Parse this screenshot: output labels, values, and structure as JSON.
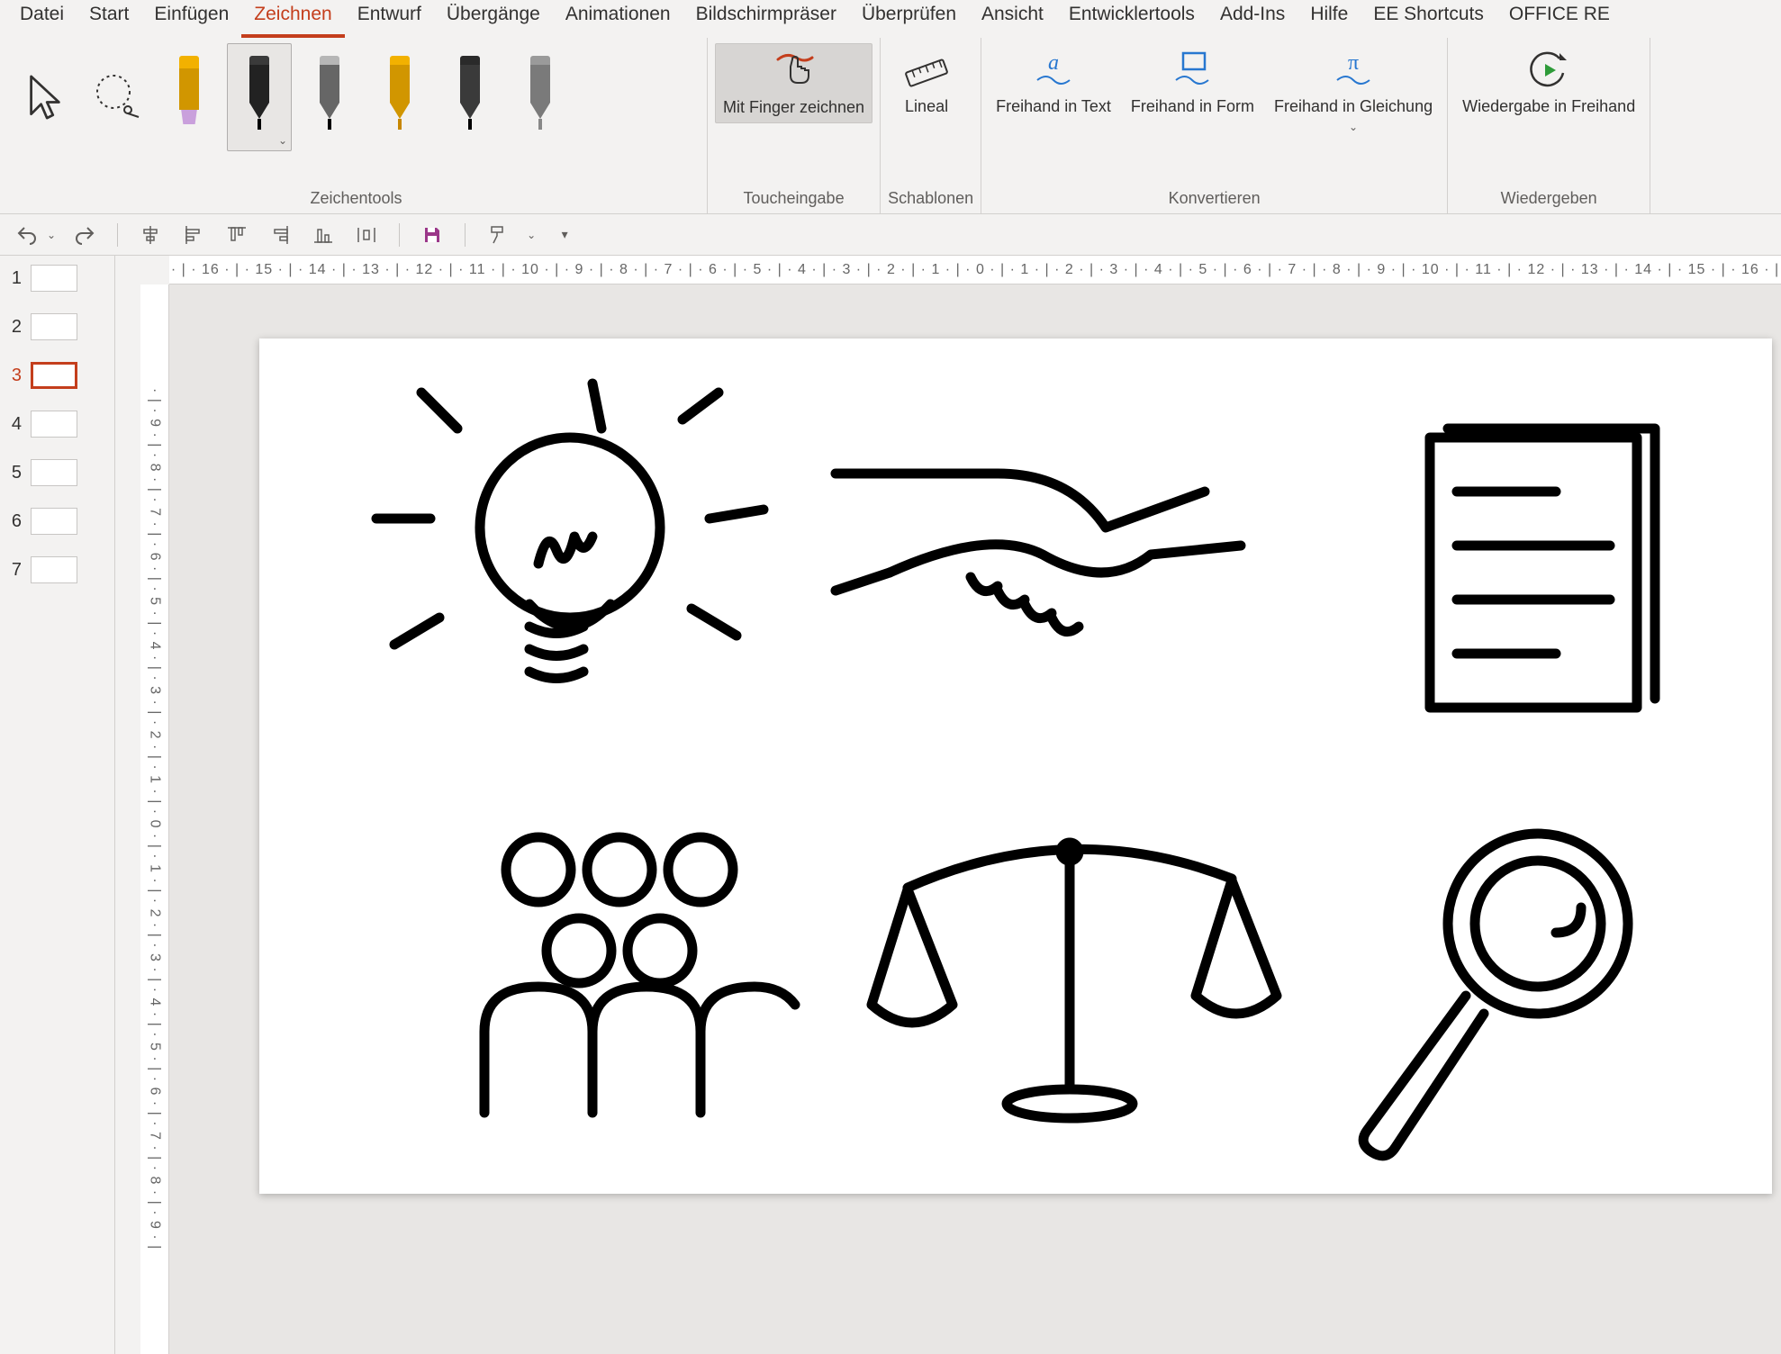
{
  "tabs": {
    "items": [
      "Datei",
      "Start",
      "Einfügen",
      "Zeichnen",
      "Entwurf",
      "Übergänge",
      "Animationen",
      "Bildschirmpräser",
      "Überprüfen",
      "Ansicht",
      "Entwicklertools",
      "Add-Ins",
      "Hilfe",
      "EE Shortcuts",
      "OFFICE RE"
    ],
    "active_index": 3
  },
  "ribbon": {
    "groups": {
      "tools": {
        "label": "Zeichentools",
        "pens": [
          {
            "name": "highlighter-yellow",
            "type": "highlighter",
            "cap": "#f2b100",
            "body": "#d19600",
            "tip": "#c9a0dc",
            "selected": false
          },
          {
            "name": "pen-black",
            "type": "pen",
            "cap": "#3a3a3a",
            "body": "#222",
            "tip": "#000",
            "selected": true
          },
          {
            "name": "pen-thin-black",
            "type": "pen",
            "cap": "#b6b6b6",
            "body": "#666",
            "tip": "#000",
            "selected": false
          },
          {
            "name": "pen-orange",
            "type": "pen",
            "cap": "#f2b100",
            "body": "#d19600",
            "tip": "#c78700",
            "selected": false
          },
          {
            "name": "pencil-black",
            "type": "pen",
            "cap": "#2a2a2a",
            "body": "#3a3a3a",
            "tip": "#000",
            "selected": false
          },
          {
            "name": "pen-gray",
            "type": "pen",
            "cap": "#9a9a9a",
            "body": "#7a7a7a",
            "tip": "#888",
            "selected": false
          }
        ]
      },
      "touch": {
        "label": "Toucheingabe",
        "finger_label": "Mit Finger zeichnen",
        "finger_active": true
      },
      "stencil": {
        "label": "Schablonen",
        "ruler_label": "Lineal"
      },
      "convert": {
        "label": "Konvertieren",
        "text_label": "Freihand in Text",
        "shape_label": "Freihand in Form",
        "math_label": "Freihand in Gleichung"
      },
      "replay": {
        "label": "Wiedergeben",
        "replay_label": "Wiedergabe in Freihand"
      }
    }
  },
  "qat": {
    "items": [
      "undo",
      "redo",
      "sep",
      "align-h",
      "align-left",
      "align-top",
      "align-right",
      "align-bottom",
      "distribute-h",
      "sep",
      "save",
      "sep",
      "format-painter",
      "more"
    ]
  },
  "ruler": {
    "horizontal": "· | · 16 · | · 15 · | · 14 · | · 13 · | · 12 · | · 11 · | · 10 · | · 9 · | · 8 · | · 7 · | · 6 · | · 5 · | · 4 · | · 3 · | · 2 · | · 1 · | · 0 · | · 1 · | · 2 · | · 3 · | · 4 · | · 5 · | · 6 · | · 7 · | · 8 · | · 9 · | · 10 · | · 11 · | · 12 · | · 13 · | · 14 · | · 15 · | · 16 · |",
    "vertical": "· | · 9 · | · 8 · | · 7 · | · 6 · | · 5 · | · 4 · | · 3 · | · 2 · | · 1 · | · 0 · | · 1 · | · 2 · | · 3 · | · 4 · | · 5 · | · 6 · | · 7 · | · 8 · | · 9 · |"
  },
  "thumbs": {
    "items": [
      1,
      2,
      3,
      4,
      5,
      6,
      7
    ],
    "selected_index": 2
  },
  "slide_content": {
    "icons": [
      "lightbulb",
      "handshake",
      "document",
      "people",
      "scales",
      "magnifying-glass"
    ]
  }
}
